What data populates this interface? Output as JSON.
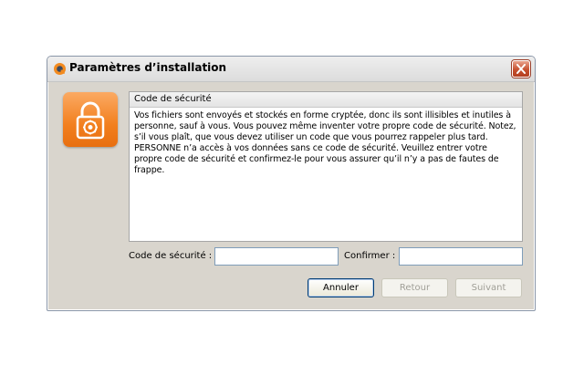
{
  "window": {
    "title": "Paramètres d’installation"
  },
  "panel": {
    "header": "Code de sécurité",
    "body": "Vos fichiers sont envoyés et stockés en forme cryptée, donc ils sont illisibles et inutiles à personne, sauf à vous. Vous pouvez même inventer votre propre code de sécurité. Notez, s’il vous plaît, que vous devez utiliser un code que vous pourrez rappeler plus tard. PERSONNE n’a accès à vos données sans ce code de sécurité. Veuillez entrer votre propre code de sécurité et confirmez-le pour vous assurer qu’il n’y a pas de fautes de frappe."
  },
  "form": {
    "code_label": "Code de sécurité :",
    "code_value": "",
    "confirm_label": "Confirmer :",
    "confirm_value": ""
  },
  "buttons": {
    "cancel": "Annuler",
    "back": "Retour",
    "next": "Suivant"
  },
  "icons": {
    "app": "app-logo-icon",
    "close": "close-icon",
    "lock": "padlock-icon"
  },
  "colors": {
    "accent": "#f27f1e",
    "close": "#c6502f"
  }
}
